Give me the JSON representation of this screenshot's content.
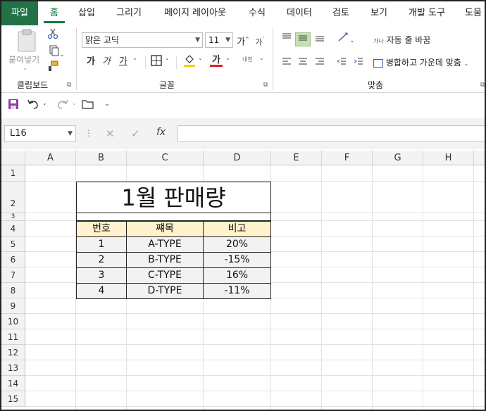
{
  "ribbon_tabs": [
    "파일",
    "홈",
    "삽입",
    "그리기",
    "페이지 레이아웃",
    "수식",
    "데이터",
    "검토",
    "보기",
    "개발 도구",
    "도움"
  ],
  "clipboard": {
    "paste_label": "붙여넣기",
    "group_label": "클립보드"
  },
  "font": {
    "name": "맑은 고딕",
    "size": "11",
    "bold": "가",
    "italic": "가",
    "underline": "가",
    "grow": "가",
    "shrink": "가",
    "font_color": "가",
    "phonetic": "내천",
    "group_label": "글꼴",
    "font_color_hex": "#e02020",
    "fill_color_hex": "#f7d000"
  },
  "alignment": {
    "wrap_text": "자동 줄 바꿈",
    "merge_center": "병합하고 가운데 맞춤",
    "group_label": "맞춤"
  },
  "formula": {
    "name_box": "L16",
    "fx": "fx",
    "value": ""
  },
  "grid": {
    "columns": [
      "A",
      "B",
      "C",
      "D",
      "E",
      "F",
      "G",
      "H"
    ],
    "rows": [
      "1",
      "2",
      "3",
      "4",
      "5",
      "6",
      "7",
      "8",
      "9",
      "10",
      "11",
      "12",
      "13",
      "14",
      "15"
    ]
  },
  "sheet": {
    "title": "1월 판매량",
    "headers": [
      "번호",
      "쨰목",
      "비고"
    ],
    "rows": [
      [
        "1",
        "A-TYPE",
        "20%"
      ],
      [
        "2",
        "B-TYPE",
        "-15%"
      ],
      [
        "3",
        "C-TYPE",
        "16%"
      ],
      [
        "4",
        "D-TYPE",
        "-11%"
      ]
    ]
  },
  "colors": {
    "accent": "#217346",
    "header_fill": "#fff2cc",
    "data_fill": "#f2f2f2"
  }
}
